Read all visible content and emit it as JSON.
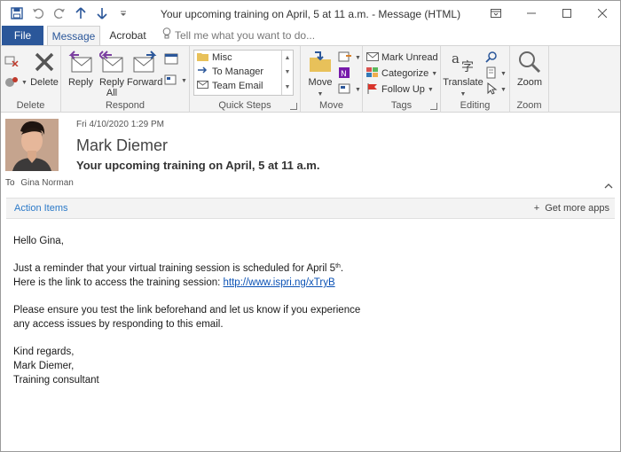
{
  "window": {
    "title": "Your upcoming training on April, 5 at 11 a.m.  -  Message (HTML)"
  },
  "tabs": {
    "file": "File",
    "message": "Message",
    "acrobat": "Acrobat",
    "tell_me": "Tell me what you want to do..."
  },
  "ribbon": {
    "delete_group": {
      "label": "Delete",
      "delete": "Delete"
    },
    "respond_group": {
      "label": "Respond",
      "reply": "Reply",
      "reply_all_1": "Reply",
      "reply_all_2": "All",
      "forward": "Forward"
    },
    "quick_steps": {
      "label": "Quick Steps",
      "items": [
        "Misc",
        "To Manager",
        "Team Email"
      ]
    },
    "move_group": {
      "label": "Move",
      "move": "Move"
    },
    "tags_group": {
      "label": "Tags",
      "mark_unread": "Mark Unread",
      "categorize": "Categorize",
      "follow_up": "Follow Up"
    },
    "editing_group": {
      "label": "Editing",
      "translate": "Translate"
    },
    "zoom_group": {
      "label": "Zoom",
      "zoom": "Zoom"
    }
  },
  "message": {
    "sent": "Fri 4/10/2020 1:29 PM",
    "sender": "Mark Diemer",
    "subject": "Your upcoming training on April, 5 at 11 a.m.",
    "to_label": "To",
    "to": "Gina Norman"
  },
  "action_bar": {
    "action_items": "Action Items",
    "get_more_apps": "Get more apps"
  },
  "body": {
    "greeting": "Hello Gina,",
    "line1_pre": "Just a reminder that your virtual training session is scheduled for April 5",
    "line1_sup": "th",
    "line1_post": ".",
    "line2_pre": "Here is the link to access the training session: ",
    "link": "http://www.ispri.ng/xTryB",
    "line3": "Please ensure you test the link beforehand and let us know if you experience",
    "line4": "any access issues by responding to this email.",
    "closing": "Kind regards,",
    "sig_name": "Mark Diemer,",
    "sig_title": "Training consultant"
  },
  "colors": {
    "accent": "#2b579a",
    "link": "#0b52b5",
    "action_items": "#2b79c8"
  }
}
